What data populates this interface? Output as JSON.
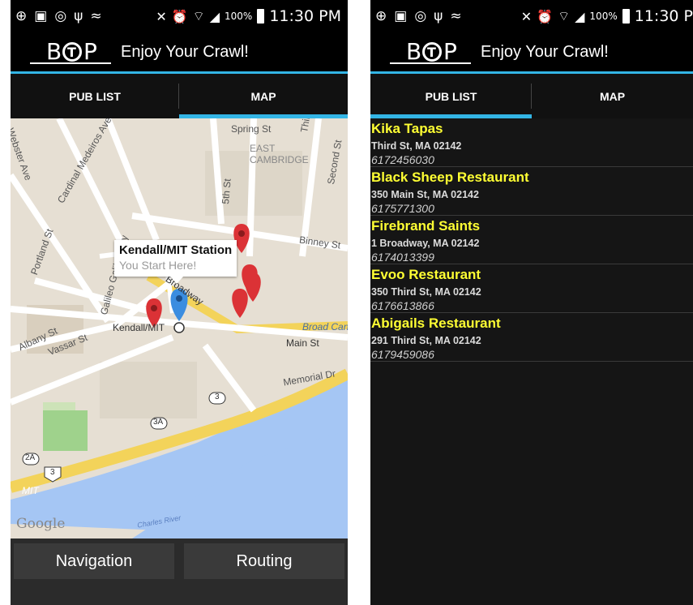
{
  "status_bar": {
    "battery": "100%",
    "time": "11:30 PM",
    "time_cut": "11:30 P"
  },
  "app": {
    "title": "Enjoy Your Crawl!",
    "logo_letters": [
      "B",
      "T",
      "P"
    ]
  },
  "tabs": [
    {
      "label": "PUB LIST"
    },
    {
      "label": "MAP"
    }
  ],
  "left_screen": {
    "active_tab": "MAP"
  },
  "right_screen": {
    "active_tab": "PUB LIST"
  },
  "map": {
    "callout": {
      "title": "Kendall/MIT Station",
      "subtitle": "You Start Here!"
    },
    "labels": {
      "spring": "Spring St",
      "east_cambridge": "EAST\nCAMBRIDGE",
      "third": "Third St",
      "second": "Second St",
      "webster": "Webster Ave",
      "cardinal": "Cardinal Medeiros Ave",
      "fifth": "5th St",
      "binney": "Binney St",
      "portland": "Portland St",
      "galileo": "Galileo Galilei Way",
      "broadway": "Broadway",
      "albany": "Albany St",
      "vassar": "Vassar St",
      "kendall": "Kendall/MIT",
      "broad_canal": "Broad Cana",
      "main": "Main St",
      "memorial": "Memorial Dr",
      "r3": "3",
      "r3a": "3A",
      "r2a": "2A",
      "us3": "3",
      "mit": "MIT",
      "charles": "Charles River"
    },
    "google": "Google",
    "colors": {
      "pin_red": "#db3236",
      "pin_blue": "#3b8de0",
      "water": "#a5c6f4",
      "highway": "#f3d35a",
      "land": "#e6dfd3"
    }
  },
  "buttons": {
    "navigation": "Navigation",
    "routing": "Routing"
  },
  "pubs": [
    {
      "name": "Kika Tapas",
      "address": "Third St, MA 02142",
      "phone": "6172456030"
    },
    {
      "name": "Black Sheep Restaurant",
      "address": "350 Main St, MA 02142",
      "phone": "6175771300"
    },
    {
      "name": "Firebrand Saints",
      "address": "1 Broadway, MA 02142",
      "phone": "6174013399"
    },
    {
      "name": "Evoo Restaurant",
      "address": "350 Third St, MA 02142",
      "phone": "6176613866"
    },
    {
      "name": "Abigails Restaurant",
      "address": "291 Third St, MA 02142",
      "phone": "6179459086"
    }
  ]
}
